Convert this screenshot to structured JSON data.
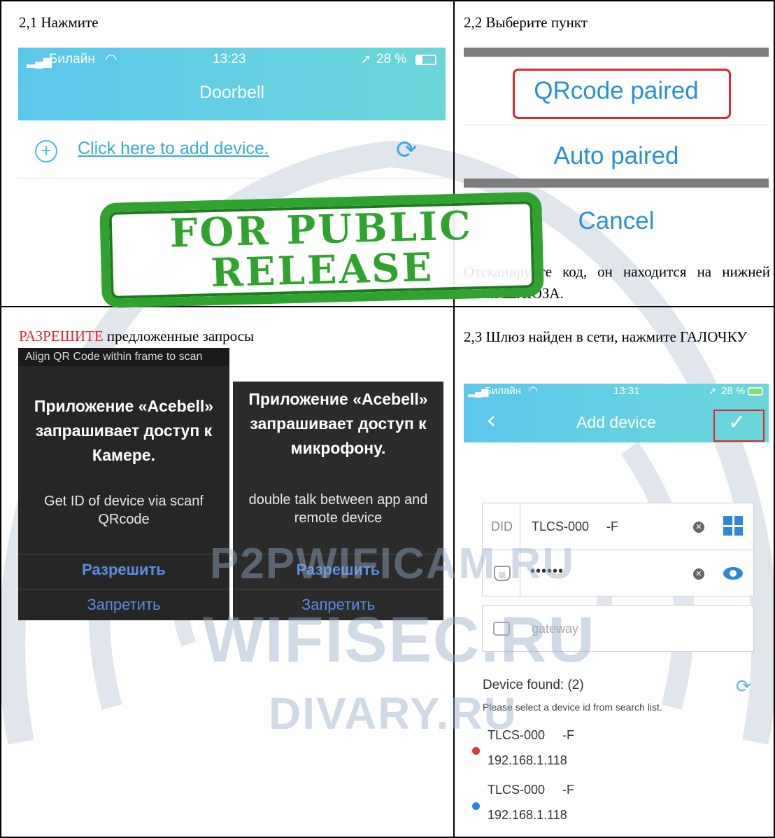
{
  "cells": {
    "c1": {
      "heading": "2,1 Нажмите"
    },
    "c2": {
      "heading": "2,2 Выберите пункт",
      "note": "Отсканируйте код, он находится на нижней части ШЛЮЗА."
    },
    "c3": {
      "heading_red": "РАЗРЕШИТЕ",
      "heading_rest": " предложенные запросы"
    },
    "c4": {
      "heading": "2,3 Шлюз найден в сети, нажмите ГАЛОЧКУ"
    }
  },
  "phone1": {
    "carrier": "Билайн",
    "time": "13:23",
    "battery": "28 %",
    "title": "Doorbell",
    "add_link": "Click here to add device."
  },
  "sheet": {
    "option1": "QRcode paired",
    "option2": "Auto paired",
    "cancel": "Cancel"
  },
  "scan_hint": "Align QR Code within frame to scan",
  "dialog_camera": {
    "title": "Приложение «Acebell» запрашивает доступ к Камере.",
    "subtitle": "Get ID of device via scanf QRcode",
    "allow": "Разрешить",
    "deny": "Запретить"
  },
  "dialog_mic": {
    "title": "Приложение «Acebell» запрашивает доступ к микрофону.",
    "subtitle": "double talk between app and remote device",
    "allow": "Разрешить",
    "deny": "Запретить"
  },
  "phone2": {
    "carrier": "Билайн",
    "time": "13:31",
    "battery": "28 %",
    "title": "Add device",
    "did_label": "DID",
    "did_value": "TLCS-000     -F",
    "password_mask": "••••••",
    "gateway_placeholder": "gateway",
    "found_label": "Device found: (2)",
    "found_hint": "Please select a device id from search list.",
    "devices": [
      {
        "id": "TLCS-000     -F",
        "ip": "192.168.1.118",
        "dot_color": "#e0343d"
      },
      {
        "id": "TLCS-000     -F",
        "ip": "192.168.1.118",
        "dot_color": "#2d86d6"
      }
    ]
  },
  "stamp": {
    "line1": "FOR PUBLIC",
    "line2": "RELEASE"
  },
  "watermarks": {
    "w1": "P2PWIFICAM.RU",
    "w2": "WIFISEC.RU",
    "w3": "DIVARY.RU"
  },
  "colors": {
    "accent_blue": "#5cc7ec",
    "stamp_green": "#2fa32d",
    "highlight_red": "#e2262e"
  }
}
